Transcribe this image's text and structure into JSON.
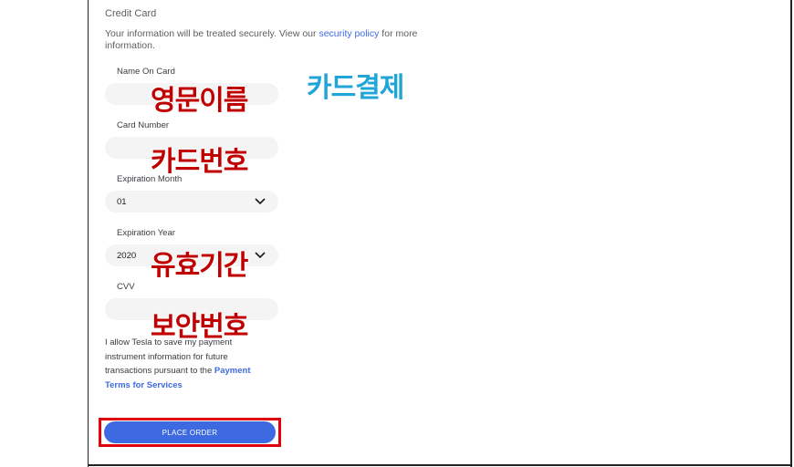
{
  "form": {
    "section_title": "Credit Card",
    "intro_prefix": "Your information will be treated securely. View our ",
    "intro_link": "security policy",
    "intro_suffix": " for more information.",
    "name_label": "Name On Card",
    "card_number_label": "Card Number",
    "exp_month_label": "Expiration Month",
    "exp_month_value": "01",
    "exp_year_label": "Expiration Year",
    "exp_year_value": "2020",
    "cvv_label": "CVV",
    "consent_text": "I allow Tesla to save my payment instrument information for future transactions pursuant to the ",
    "consent_link": "Payment Terms for Services",
    "place_order": "PLACE ORDER"
  },
  "annotations": {
    "title": "카드결제",
    "name": "영문이름",
    "card_number": "카드번호",
    "validity": "유효기간",
    "security_code": "보안번호"
  },
  "colors": {
    "accent": "#3e6ae1",
    "highlight_outline": "#e0000b",
    "annotation_red": "#c00000",
    "annotation_cyan": "#1fa5d6"
  }
}
